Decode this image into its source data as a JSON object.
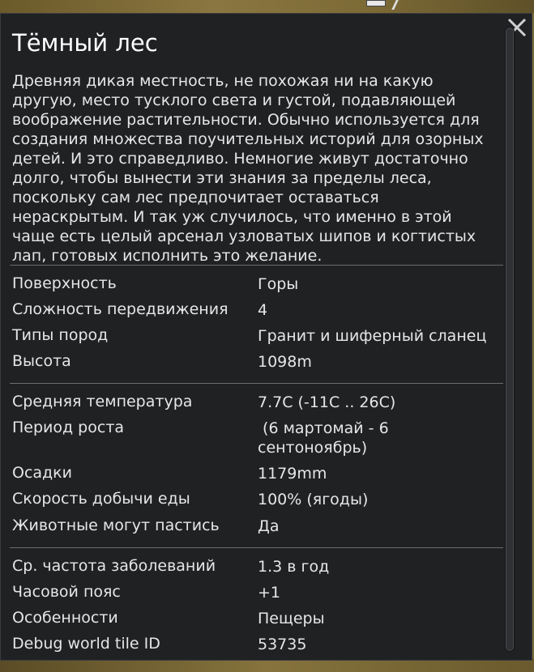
{
  "window": {
    "title": "Тёмный лес",
    "description": "Древняя дикая местность, не похожая ни на какую другую, место тусклого света и густой, подавляющей воображение растительности. Обычно используется для создания множества поучительных историй для озорных детей. И это справедливо. Немногие живут достаточно долго, чтобы вынести эти знания за пределы леса, поскольку сам лес предпочитает оставаться нераскрытым. И так уж случилось, что именно в этой чаще есть целый арсенал узловатых шипов и когтистых лап, готовых исполнить это желание.",
    "close_icon": "close-icon"
  },
  "group1": [
    {
      "label": "Поверхность",
      "value": "Горы"
    },
    {
      "label": "Сложность передвижения",
      "value": "4"
    },
    {
      "label": "Типы пород",
      "value": "Гранит и шиферный сланец"
    },
    {
      "label": "Высота",
      "value": "1098m"
    }
  ],
  "group2": [
    {
      "label": "Средняя температура",
      "value": "7.7C (-11C .. 26C)"
    },
    {
      "label": "Период роста",
      "value": " (6 мартомай - 6 сентоноябрь)"
    },
    {
      "label": "Осадки",
      "value": "1179mm"
    },
    {
      "label": "Скорость добычи еды",
      "value": "100% (ягоды)"
    },
    {
      "label": "Животные могут пастись",
      "value": "Да"
    }
  ],
  "group3": [
    {
      "label": "Ср. частота заболеваний",
      "value": "1.3 в год"
    },
    {
      "label": "Часовой пояс",
      "value": "+1"
    },
    {
      "label": "Особенности",
      "value": "Пещеры"
    },
    {
      "label": "Debug world tile ID",
      "value": "53735"
    }
  ],
  "colors": {
    "panel_bg": "#1f2123",
    "text": "#e6e6e6",
    "title": "#ffffff",
    "divider": "#6a6d70"
  }
}
